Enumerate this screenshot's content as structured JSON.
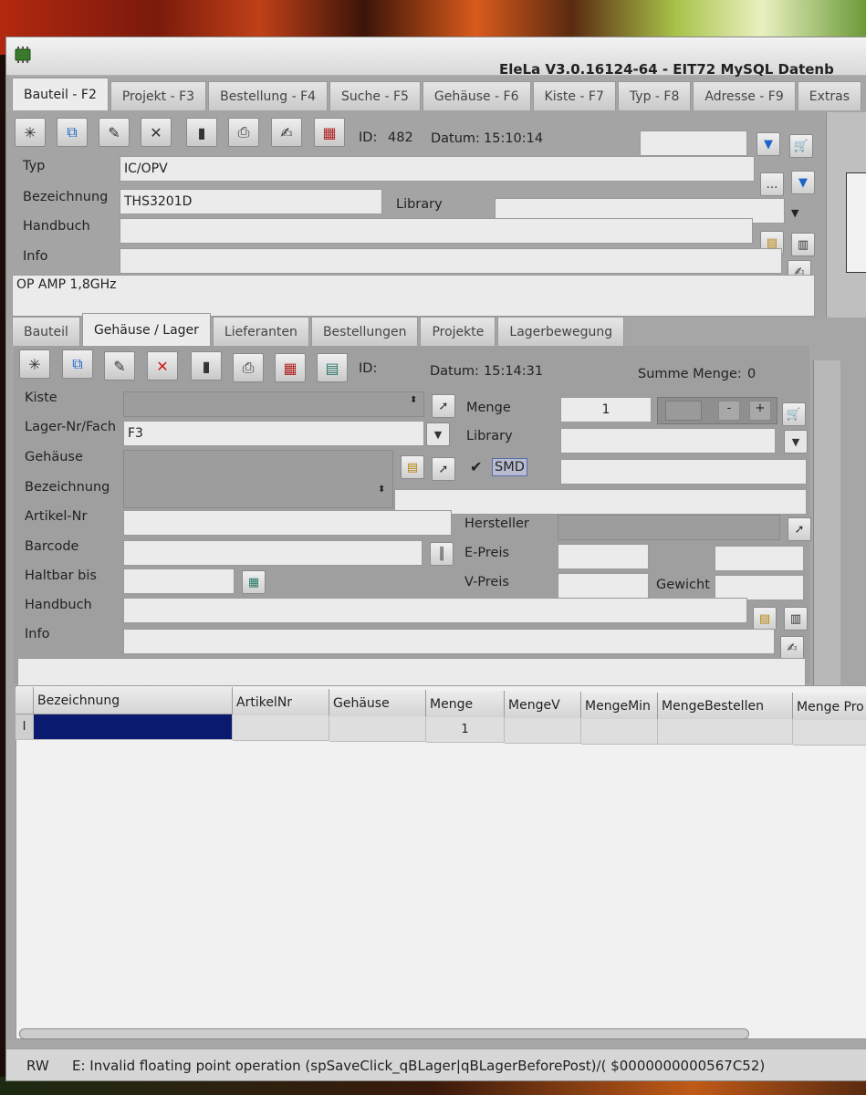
{
  "window": {
    "title": "EleLa V3.0.16124-64 - EIT72 MySQL Datenb"
  },
  "main_tabs": [
    {
      "label": "Bauteil - F2"
    },
    {
      "label": "Projekt - F3"
    },
    {
      "label": "Bestellung - F4"
    },
    {
      "label": "Suche - F5"
    },
    {
      "label": "Gehäuse - F6"
    },
    {
      "label": "Kiste - F7"
    },
    {
      "label": "Typ - F8"
    },
    {
      "label": "Adresse - F9"
    },
    {
      "label": "Extras"
    }
  ],
  "part": {
    "id_label": "ID:",
    "id_value": "482",
    "datum_label": "Datum:",
    "datum_value": "15:10:14",
    "search_value": "",
    "typ_label": "Typ",
    "typ_value": "IC/OPV",
    "bezeichnung_label": "Bezeichnung",
    "bezeichnung_value": "THS3201D",
    "library_label": "Library",
    "library_value": "",
    "handbuch_label": "Handbuch",
    "handbuch_value": "",
    "info_label": "Info",
    "info_value": "",
    "description": "OP AMP 1,8GHz"
  },
  "sub_tabs": [
    {
      "label": "Bauteil"
    },
    {
      "label": "Gehäuse / Lager"
    },
    {
      "label": "Lieferanten"
    },
    {
      "label": "Bestellungen"
    },
    {
      "label": "Projekte"
    },
    {
      "label": "Lagerbewegung"
    }
  ],
  "stock": {
    "id_label": "ID:",
    "datum_label": "Datum:",
    "datum_value": "15:14:31",
    "summe_label": "Summe Menge:",
    "summe_value": "0",
    "kiste_label": "Kiste",
    "kiste_value": "",
    "menge_label": "Menge",
    "menge_value": "1",
    "lager_label": "Lager-Nr/Fach",
    "lager_value": "F3",
    "library_label": "Library",
    "library_value": "",
    "gehaeuse_label": "Gehäuse",
    "gehaeuse_value": "",
    "smd_label": "SMD",
    "smd_checked": true,
    "smd_extra_value": "",
    "bezeichnung_label": "Bezeichnung",
    "bezeichnung_value": "",
    "artikel_label": "Artikel-Nr",
    "artikel_value": "",
    "hersteller_label": "Hersteller",
    "hersteller_value": "",
    "barcode_label": "Barcode",
    "barcode_value": "",
    "epreis_label": "E-Preis",
    "epreis_value": "",
    "haltbar_label": "Haltbar bis",
    "haltbar_value": "",
    "vpreis_label": "V-Preis",
    "vpreis_value": "",
    "gewicht_label": "Gewicht",
    "gewicht_value": "",
    "handbuch_label": "Handbuch",
    "handbuch_value": "",
    "info_label": "Info",
    "info_value": ""
  },
  "grid": {
    "columns": [
      "Bezeichnung",
      "ArtikelNr",
      "Gehäuse",
      "Menge",
      "MengeV",
      "MengeMin",
      "MengeBestellen",
      "Menge Pro"
    ],
    "row_marker": "I",
    "rows": [
      [
        "",
        "",
        "",
        "1",
        "",
        "",
        "",
        ""
      ]
    ]
  },
  "status": {
    "mode": "RW",
    "message": "E: Invalid floating point operation (spSaveClick_qBLager|qBLagerBeforePost)/(  $0000000000567C52)"
  }
}
